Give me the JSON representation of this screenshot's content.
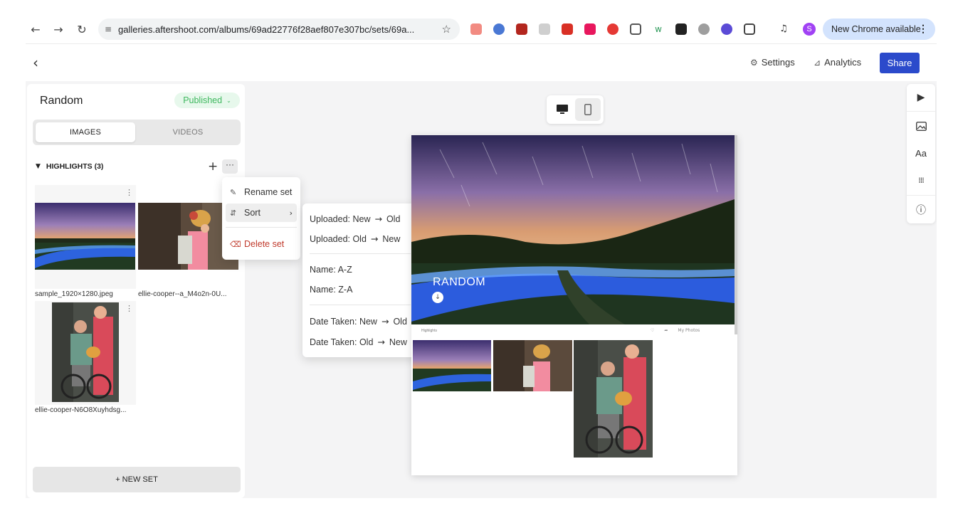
{
  "browser": {
    "url": "galleries.aftershoot.com/albums/69ad22776f28aef807e307bc/sets/69a...",
    "update_label": "New Chrome available",
    "profile_initial": "S"
  },
  "header": {
    "settings_label": "Settings",
    "analytics_label": "Analytics",
    "share_label": "Share"
  },
  "panel": {
    "set_title": "Random",
    "status": "Published",
    "tabs": [
      "IMAGES",
      "VIDEOS"
    ],
    "section_label": "HIGHLIGHTS (3)",
    "thumbnails": [
      {
        "name": "sample_1920×1280.jpeg"
      },
      {
        "name": "ellie-cooper--a_M4o2n-0U..."
      },
      {
        "name": "ellie-cooper-N6O8Xuyhdsg..."
      }
    ],
    "new_set_label": "+ NEW SET"
  },
  "context_menu": {
    "rename": "Rename set",
    "sort": "Sort",
    "delete": "Delete set"
  },
  "sort_menu": [
    {
      "label": "Uploaded: New",
      "to": "Old"
    },
    {
      "label": "Uploaded: Old",
      "to": "New"
    },
    {
      "label": "Name: A-Z"
    },
    {
      "label": "Name: Z-A"
    },
    {
      "label": "Date Taken: New",
      "to": "Old"
    },
    {
      "label": "Date Taken: Old",
      "to": "New"
    }
  ],
  "preview": {
    "hero_title": "RANDOM",
    "strip_label": "Highlights",
    "strip_right_label": "My Photos"
  },
  "colors": {
    "accent": "#2b4acb",
    "published_bg": "#e7f8ec",
    "published_text": "#3fb85f",
    "danger": "#c0392b"
  }
}
